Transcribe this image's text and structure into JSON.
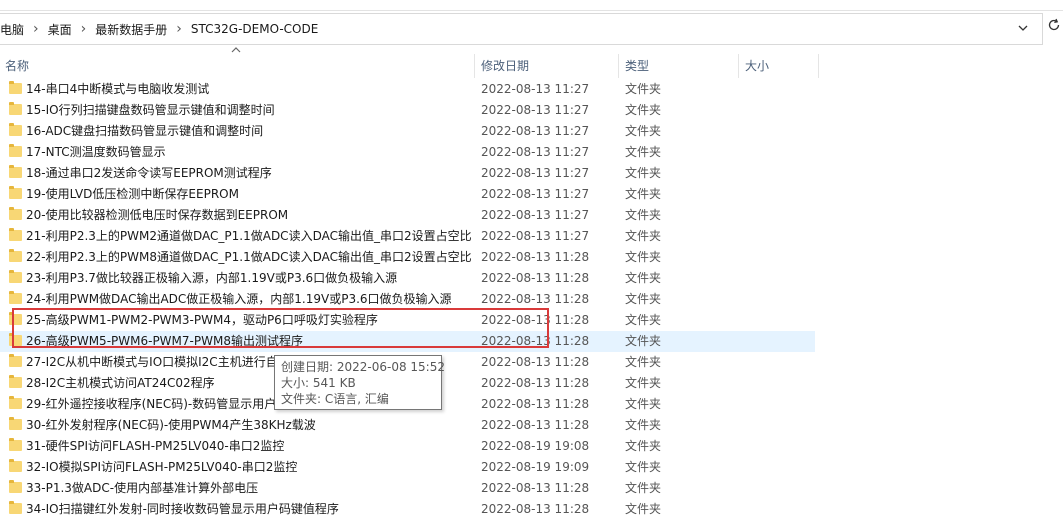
{
  "breadcrumb": [
    "电脑",
    "桌面",
    "最新数据手册",
    "STC32G-DEMO-CODE"
  ],
  "breadcrumb_separator": "›",
  "columns": {
    "name": "名称",
    "date": "修改日期",
    "type": "类型",
    "size": "大小"
  },
  "icons": {
    "dropdown": "chevron-down-icon",
    "refresh": "refresh-icon",
    "folder": "folder-icon",
    "sort": "sort-up-icon"
  },
  "colors": {
    "folder": "#f8d775",
    "hover_row": "#e5f3ff",
    "highlight_box": "#d93a3a"
  },
  "files": [
    {
      "name": "14-串口4中断模式与电脑收发测试",
      "date": "2022-08-13 11:27",
      "type": "文件夹"
    },
    {
      "name": "15-IO行列扫描键盘数码管显示键值和调整时间",
      "date": "2022-08-13 11:27",
      "type": "文件夹"
    },
    {
      "name": "16-ADC键盘扫描数码管显示键值和调整时间",
      "date": "2022-08-13 11:27",
      "type": "文件夹"
    },
    {
      "name": "17-NTC测温度数码管显示",
      "date": "2022-08-13 11:27",
      "type": "文件夹"
    },
    {
      "name": "18-通过串口2发送命令读写EEPROM测试程序",
      "date": "2022-08-13 11:27",
      "type": "文件夹"
    },
    {
      "name": "19-使用LVD低压检测中断保存EEPROM",
      "date": "2022-08-13 11:27",
      "type": "文件夹"
    },
    {
      "name": "20-使用比较器检测低电压时保存数据到EEPROM",
      "date": "2022-08-13 11:27",
      "type": "文件夹"
    },
    {
      "name": "21-利用P2.3上的PWM2通道做DAC_P1.1做ADC读入DAC输出值_串口2设置占空比",
      "date": "2022-08-13 11:27",
      "type": "文件夹"
    },
    {
      "name": "22-利用P2.3上的PWM8通道做DAC_P1.1做ADC读入DAC输出值_串口2设置占空比",
      "date": "2022-08-13 11:28",
      "type": "文件夹"
    },
    {
      "name": "23-利用P3.7做比较器正极输入源，内部1.19V或P3.6口做负极输入源",
      "date": "2022-08-13 11:28",
      "type": "文件夹"
    },
    {
      "name": "24-利用PWM做DAC输出ADC做正极输入源，内部1.19V或P3.6口做负极输入源",
      "date": "2022-08-13 11:28",
      "type": "文件夹"
    },
    {
      "name": "25-高级PWM1-PWM2-PWM3-PWM4，驱动P6口呼吸灯实验程序",
      "date": "2022-08-13 11:28",
      "type": "文件夹"
    },
    {
      "name": "26-高级PWM5-PWM6-PWM7-PWM8输出测试程序",
      "date": "2022-08-13 11:28",
      "type": "文件夹"
    },
    {
      "name": "27-I2C从机中断模式与IO口模拟I2C主机进行自",
      "date": "2022-08-13 11:28",
      "type": "文件夹"
    },
    {
      "name": "28-I2C主机模式访问AT24C02程序",
      "date": "2022-08-13 11:28",
      "type": "文件夹"
    },
    {
      "name": "29-红外遥控接收程序(NEC码)-数码管显示用户",
      "date": "2022-08-13 11:28",
      "type": "文件夹"
    },
    {
      "name": "30-红外发射程序(NEC码)-使用PWM4产生38KHz载波",
      "date": "2022-08-13 11:28",
      "type": "文件夹"
    },
    {
      "name": "31-硬件SPI访问FLASH-PM25LV040-串口2监控",
      "date": "2022-08-19 19:08",
      "type": "文件夹"
    },
    {
      "name": "32-IO模拟SPI访问FLASH-PM25LV040-串口2监控",
      "date": "2022-08-19 19:09",
      "type": "文件夹"
    },
    {
      "name": "33-P1.3做ADC-使用内部基准计算外部电压",
      "date": "2022-08-13 11:28",
      "type": "文件夹"
    },
    {
      "name": "34-IO扫描键红外发射-同时接收数码管显示用户码键值程序",
      "date": "2022-08-13 11:28",
      "type": "文件夹"
    }
  ],
  "hover_index": 12,
  "tooltip": {
    "created": "创建日期: 2022-06-08 15:52",
    "size": "大小: 541 KB",
    "files": "文件夹: C语言, 汇编"
  }
}
